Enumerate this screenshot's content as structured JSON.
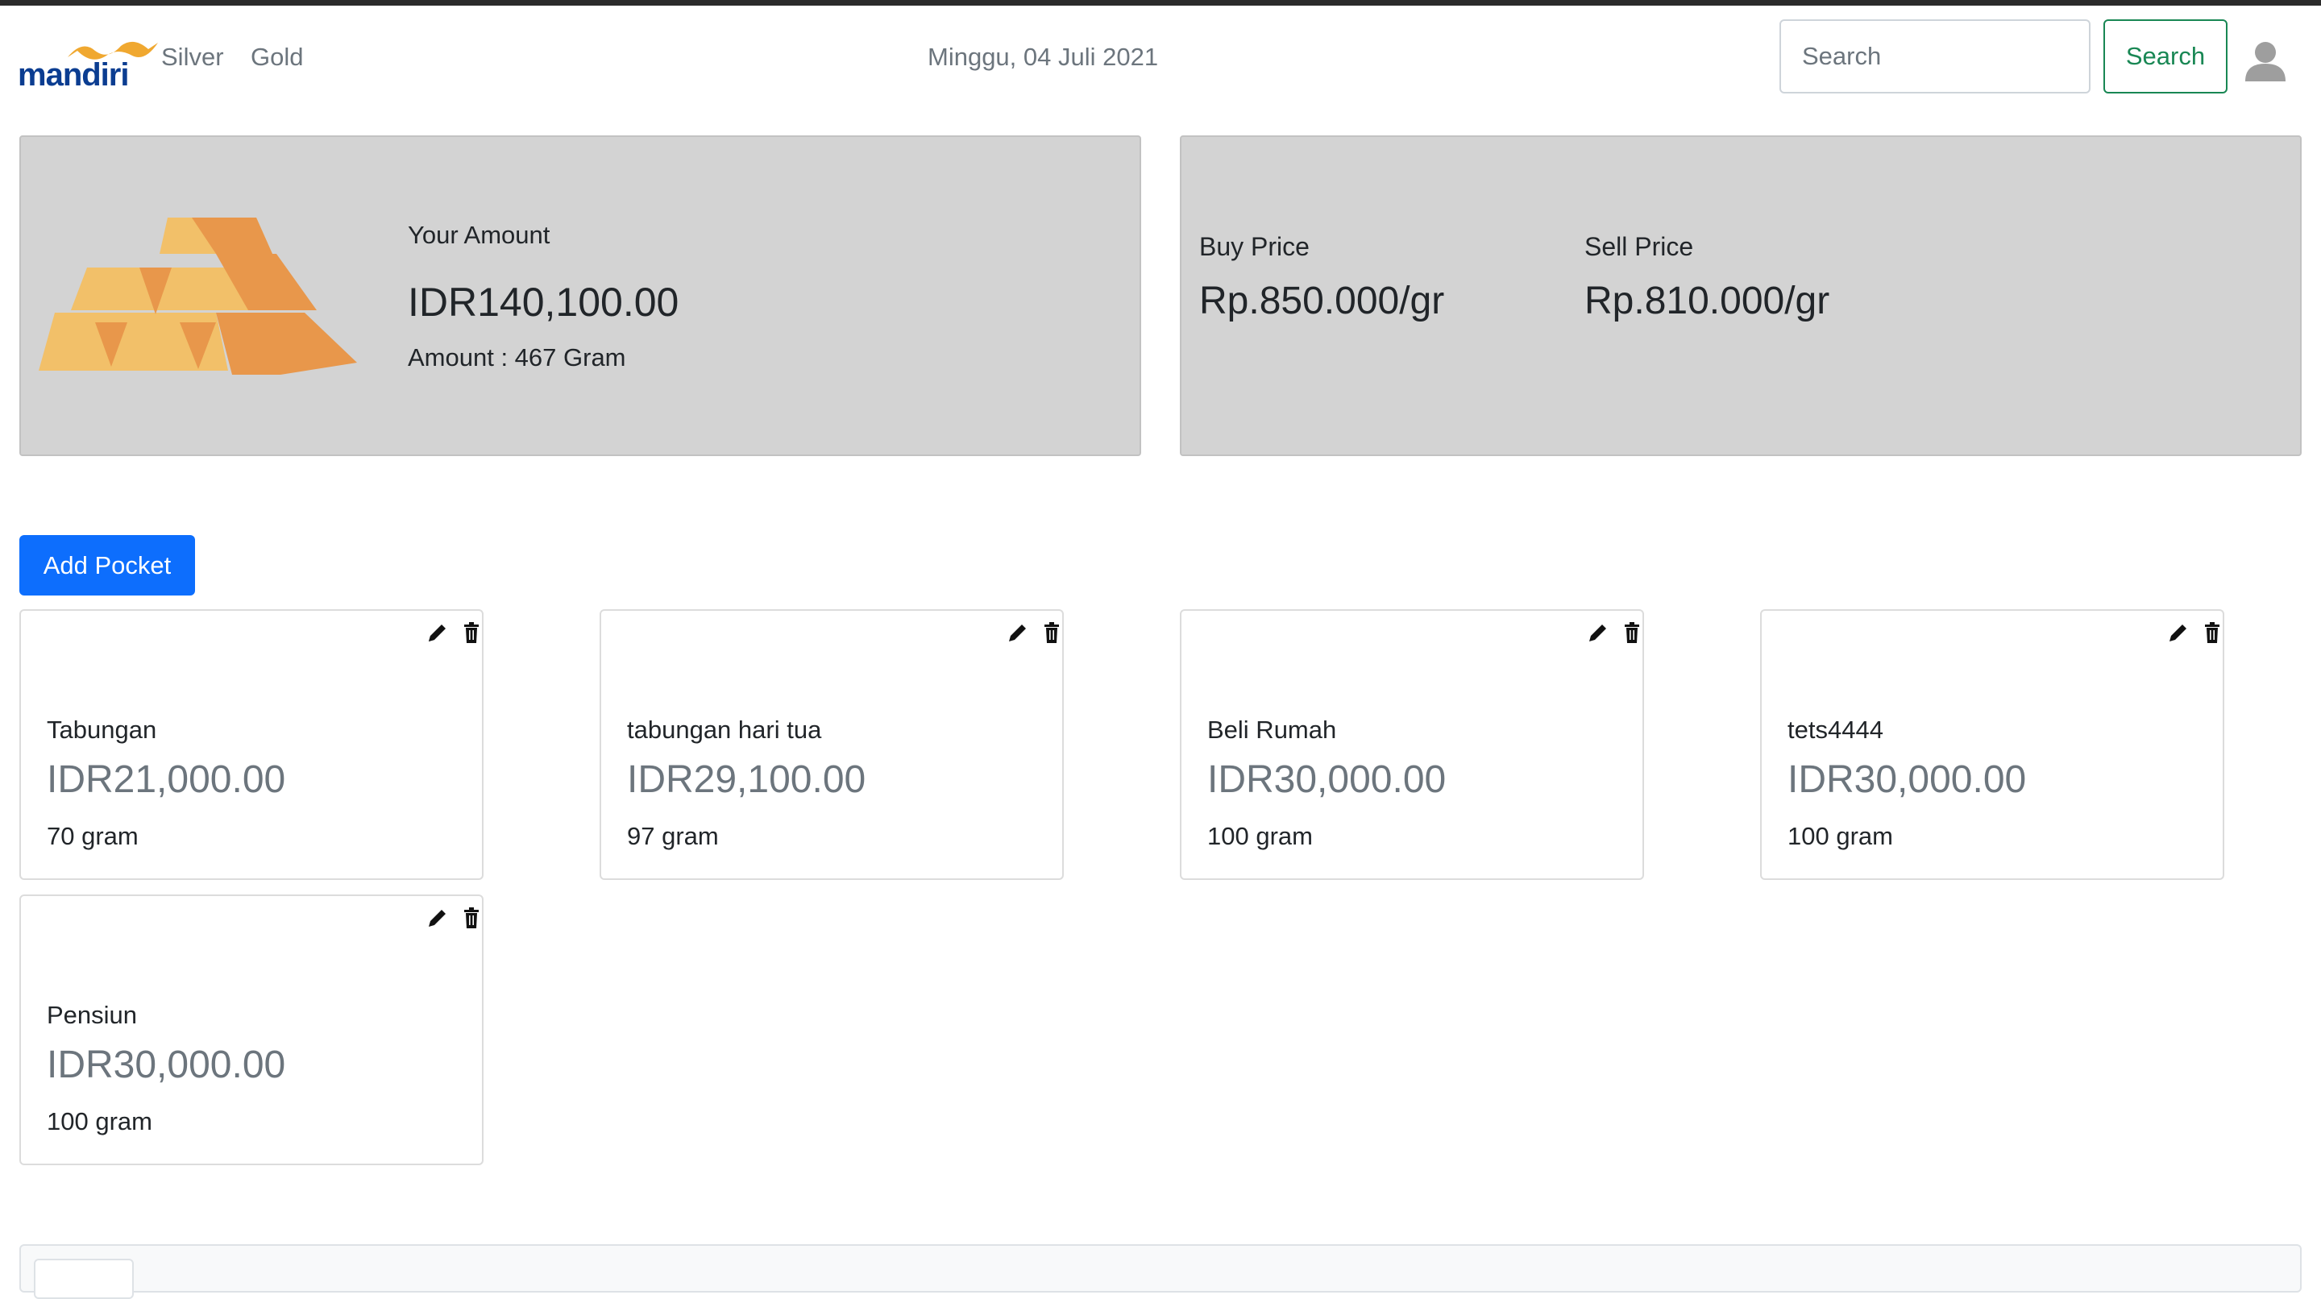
{
  "brand": {
    "logo_text": "mandiri"
  },
  "nav": {
    "links": [
      "Silver",
      "Gold"
    ],
    "date": "Minggu, 04 Juli 2021",
    "search_placeholder": "Search",
    "search_value": "",
    "search_button": "Search"
  },
  "summary": {
    "label": "Your Amount",
    "value": "IDR140,100.00",
    "gram": "Amount : 467 Gram"
  },
  "prices": {
    "buy_label": "Buy Price",
    "buy_value": "Rp.850.000/gr",
    "sell_label": "Sell Price",
    "sell_value": "Rp.810.000/gr"
  },
  "add_pocket_label": "Add Pocket",
  "pockets": [
    {
      "name": "Tabungan",
      "value": "IDR21,000.00",
      "gram": "70 gram"
    },
    {
      "name": "tabungan hari tua",
      "value": "IDR29,100.00",
      "gram": "97 gram"
    },
    {
      "name": "Beli Rumah",
      "value": "IDR30,000.00",
      "gram": "100 gram"
    },
    {
      "name": "tets4444",
      "value": "IDR30,000.00",
      "gram": "100 gram"
    },
    {
      "name": "Pensiun",
      "value": "IDR30,000.00",
      "gram": "100 gram"
    }
  ],
  "colors": {
    "primary": "#0d6efd",
    "success": "#198754",
    "panel_bg": "#d3d3d3",
    "muted": "#6c757d",
    "gold_light": "#f2c069",
    "gold_dark": "#e8974b",
    "logo_blue": "#0b3d91"
  },
  "icons": {
    "edit": "pencil-icon",
    "delete": "trash-icon",
    "user": "user-icon",
    "gold": "gold-bars-illustration"
  }
}
